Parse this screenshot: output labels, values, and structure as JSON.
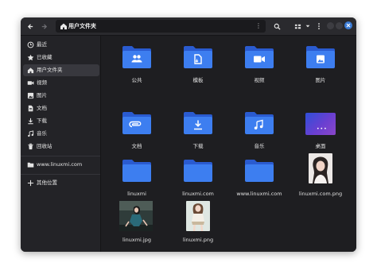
{
  "header": {
    "path_label": "用户文件夹",
    "path_menu": "⋮"
  },
  "sidebar": {
    "items": [
      {
        "label": "最近",
        "icon": "clock-icon"
      },
      {
        "label": "已收藏",
        "icon": "star-icon"
      },
      {
        "label": "用户文件夹",
        "icon": "home-icon",
        "active": true
      },
      {
        "label": "视频",
        "icon": "video-icon"
      },
      {
        "label": "图片",
        "icon": "image-icon"
      },
      {
        "label": "文档",
        "icon": "document-icon"
      },
      {
        "label": "下载",
        "icon": "download-icon"
      },
      {
        "label": "音乐",
        "icon": "music-icon"
      },
      {
        "label": "回收站",
        "icon": "trash-icon"
      }
    ],
    "bookmarks": [
      {
        "label": "www.linuxmi.com",
        "icon": "folder-icon"
      }
    ],
    "other_locations": {
      "label": "其他位置",
      "icon": "plus-icon"
    }
  },
  "files": [
    {
      "name": "公共",
      "kind": "folder",
      "emblem": "people-icon"
    },
    {
      "name": "模板",
      "kind": "folder",
      "emblem": "template-icon"
    },
    {
      "name": "视频",
      "kind": "folder",
      "emblem": "video-icon"
    },
    {
      "name": "图片",
      "kind": "folder",
      "emblem": "image-icon"
    },
    {
      "name": "文档",
      "kind": "folder",
      "emblem": "paperclip-icon"
    },
    {
      "name": "下载",
      "kind": "folder",
      "emblem": "download-icon"
    },
    {
      "name": "音乐",
      "kind": "folder",
      "emblem": "music-icon"
    },
    {
      "name": "桌面",
      "kind": "desktop"
    },
    {
      "name": "linuxmi",
      "kind": "folder"
    },
    {
      "name": "linuxmi.com",
      "kind": "folder"
    },
    {
      "name": "www.linuxmi.com",
      "kind": "folder"
    },
    {
      "name": "linuxmi.com.png",
      "kind": "image"
    },
    {
      "name": "linuxmi.jpg",
      "kind": "image"
    },
    {
      "name": "linuxmi.png",
      "kind": "image"
    }
  ],
  "colors": {
    "accent": "#3a7bd5",
    "folder_back": "#2a5bd0",
    "folder_front": "#3d7ef0",
    "window_bg": "#202024"
  }
}
